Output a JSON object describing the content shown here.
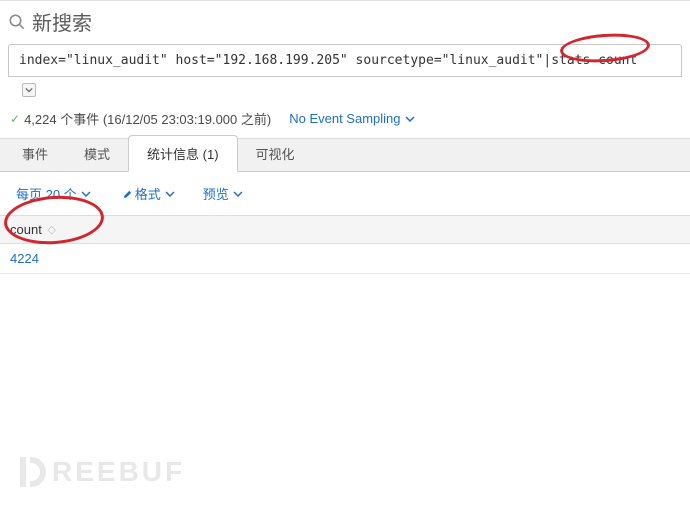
{
  "header": {
    "title": "新搜索",
    "query": "index=\"linux_audit\" host=\"192.168.199.205\" sourcetype=\"linux_audit\"|stats count"
  },
  "status": {
    "event_count_text": "4,224 个事件 (16/12/05 23:03:19.000 之前)",
    "sampling_label": "No Event Sampling"
  },
  "tabs": {
    "events": "事件",
    "patterns": "模式",
    "statistics": "统计信息 (1)",
    "visualization": "可视化"
  },
  "toolbar": {
    "per_page": "每页 20 个",
    "format": "格式",
    "preview": "预览"
  },
  "table": {
    "header_count": "count",
    "row_value": "4224"
  },
  "watermark": {
    "text": "REEBUF"
  }
}
